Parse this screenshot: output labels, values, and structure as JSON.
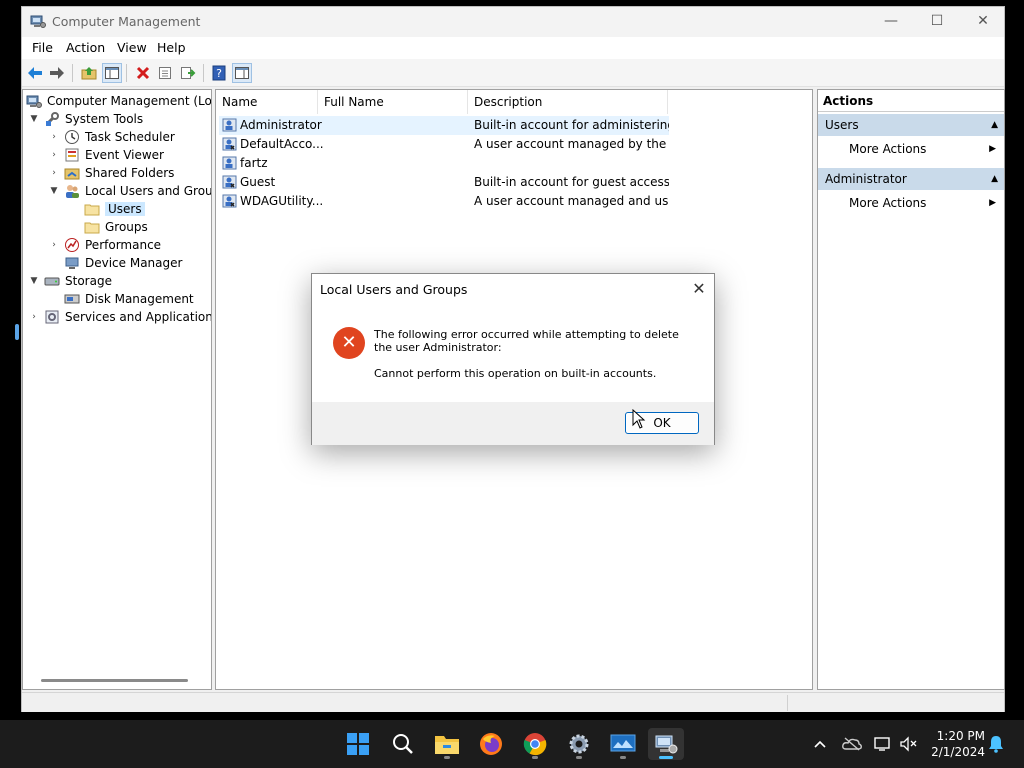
{
  "window": {
    "title": "Computer Management",
    "minimize_glyph": "—",
    "maximize_glyph": "☐",
    "close_glyph": "✕"
  },
  "menu": [
    "File",
    "Action",
    "View",
    "Help"
  ],
  "toolbar_icons": [
    "back-arrow-icon",
    "forward-arrow-icon",
    "up-folder-icon",
    "show-hide-tree-icon",
    "delete-icon",
    "properties-icon",
    "export-list-icon",
    "help-icon",
    "show-action-pane-icon"
  ],
  "tree": [
    {
      "label": "Computer Management (Local",
      "depth": 0,
      "chevron": "",
      "icon": "computer-management-icon"
    },
    {
      "label": "System Tools",
      "depth": 1,
      "chevron": "expanded",
      "icon": "system-tools-icon"
    },
    {
      "label": "Task Scheduler",
      "depth": 2,
      "chevron": "collapsed",
      "icon": "clock-icon"
    },
    {
      "label": "Event Viewer",
      "depth": 2,
      "chevron": "collapsed",
      "icon": "event-viewer-icon"
    },
    {
      "label": "Shared Folders",
      "depth": 2,
      "chevron": "collapsed",
      "icon": "shared-folder-icon"
    },
    {
      "label": "Local Users and Groups",
      "depth": 2,
      "chevron": "expanded",
      "icon": "users-groups-icon"
    },
    {
      "label": "Users",
      "depth": 3,
      "chevron": "",
      "icon": "folder-icon",
      "selected": true
    },
    {
      "label": "Groups",
      "depth": 3,
      "chevron": "",
      "icon": "folder-icon"
    },
    {
      "label": "Performance",
      "depth": 2,
      "chevron": "collapsed",
      "icon": "performance-icon"
    },
    {
      "label": "Device Manager",
      "depth": 2,
      "chevron": "",
      "icon": "device-manager-icon"
    },
    {
      "label": "Storage",
      "depth": 1,
      "chevron": "expanded",
      "icon": "storage-icon"
    },
    {
      "label": "Disk Management",
      "depth": 2,
      "chevron": "",
      "icon": "disk-management-icon"
    },
    {
      "label": "Services and Applications",
      "depth": 1,
      "chevron": "collapsed",
      "icon": "services-icon"
    }
  ],
  "list": {
    "columns": [
      "Name",
      "Full Name",
      "Description"
    ],
    "rows": [
      {
        "name": "Administrator",
        "full_name": "",
        "description": "Built-in account for administering...",
        "selected": true
      },
      {
        "name": "DefaultAcco...",
        "full_name": "",
        "description": "A user account managed by the s..."
      },
      {
        "name": "fartz",
        "full_name": "",
        "description": ""
      },
      {
        "name": "Guest",
        "full_name": "",
        "description": "Built-in account for guest access t..."
      },
      {
        "name": "WDAGUtility...",
        "full_name": "",
        "description": "A user account managed and use..."
      }
    ]
  },
  "actions": {
    "header": "Actions",
    "sections": [
      {
        "title": "Users",
        "items": [
          "More Actions"
        ]
      },
      {
        "title": "Administrator",
        "items": [
          "More Actions"
        ]
      }
    ]
  },
  "dialog": {
    "title": "Local Users and Groups",
    "message_line1": "The following error occurred while attempting to delete the user Administrator:",
    "message_line2": "Cannot perform this operation on built-in accounts.",
    "ok_label": "OK",
    "icon": "error-icon"
  },
  "taskbar": {
    "apps": [
      "windows-start-icon",
      "search-icon",
      "file-explorer-icon",
      "firefox-icon",
      "chrome-icon",
      "settings-icon",
      "remote-desktop-icon",
      "computer-management-icon"
    ],
    "tray": [
      "chevron-up-icon",
      "onedrive-icon",
      "network-icon",
      "volume-muted-icon",
      "notification-bell-icon"
    ],
    "time": "1:20 PM",
    "date": "2/1/2024"
  },
  "colors": {
    "accent": "#0067c0",
    "selection": "#cce8ff",
    "action_section": "#c9daea",
    "error_red": "#e0441f",
    "taskbar": "#1c1c1c"
  }
}
